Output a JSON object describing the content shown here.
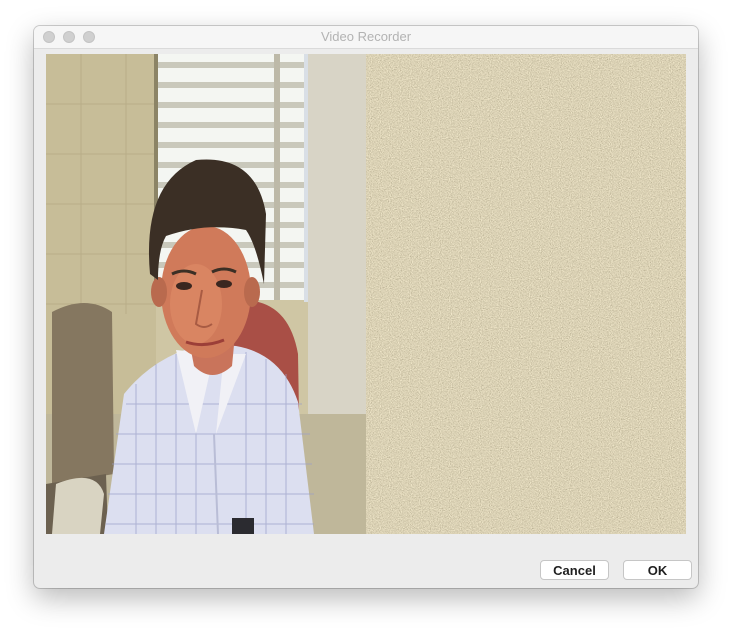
{
  "window": {
    "title": "Video Recorder"
  },
  "buttons": {
    "cancel_label": "Cancel",
    "ok_label": "OK"
  }
}
